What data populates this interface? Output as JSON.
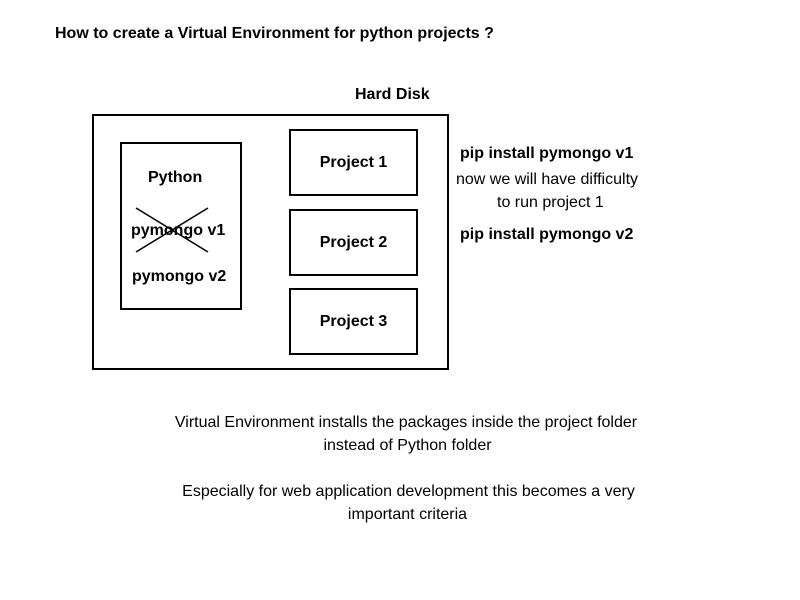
{
  "title": "How to create a Virtual Environment for python projects ?",
  "diagram": {
    "container_label": "Hard Disk",
    "python_folder": {
      "label": "Python",
      "packages": [
        {
          "name": "pymongo v1",
          "crossed_out": true
        },
        {
          "name": "pymongo v2",
          "crossed_out": false
        }
      ]
    },
    "projects": [
      "Project 1",
      "Project 2",
      "Project 3"
    ]
  },
  "notes": {
    "cmd_v1": "pip install pymongo v1",
    "difficulty_line1": "now we will have difficulty",
    "difficulty_line2": "to run project 1",
    "cmd_v2": "pip install pymongo v2"
  },
  "captions": {
    "line1": "Virtual Environment installs the packages inside the project folder",
    "line2": "instead of Python folder",
    "line3": "Especially for web application development this becomes a very",
    "line4": "important criteria"
  }
}
